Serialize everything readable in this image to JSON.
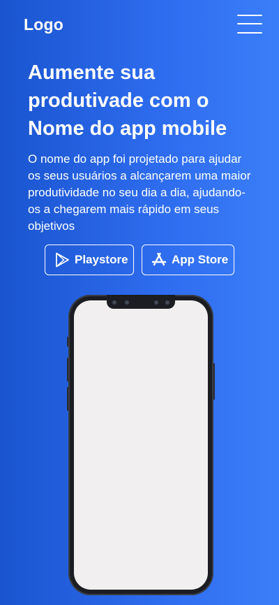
{
  "header": {
    "logo": "Logo",
    "menu_icon": "hamburger-menu-icon"
  },
  "hero": {
    "headline": "Aumente sua produtivade com o Nome do app mobile",
    "description": "O nome do app foi projetado para ajudar os seus usuários a alcançarem uma maior produtividade no seu dia a dia, ajudando-os a chegarem mais rápido em seus objetivos"
  },
  "buttons": {
    "playstore": {
      "label": "Playstore",
      "icon": "play-store-icon"
    },
    "appstore": {
      "label": "App Store",
      "icon": "app-store-icon"
    }
  },
  "colors": {
    "gradient_start": "#1a55cf",
    "gradient_end": "#3b7ef8",
    "text": "#ffffff",
    "phone_screen": "#f1efef",
    "phone_frame": "#1b1d22"
  }
}
